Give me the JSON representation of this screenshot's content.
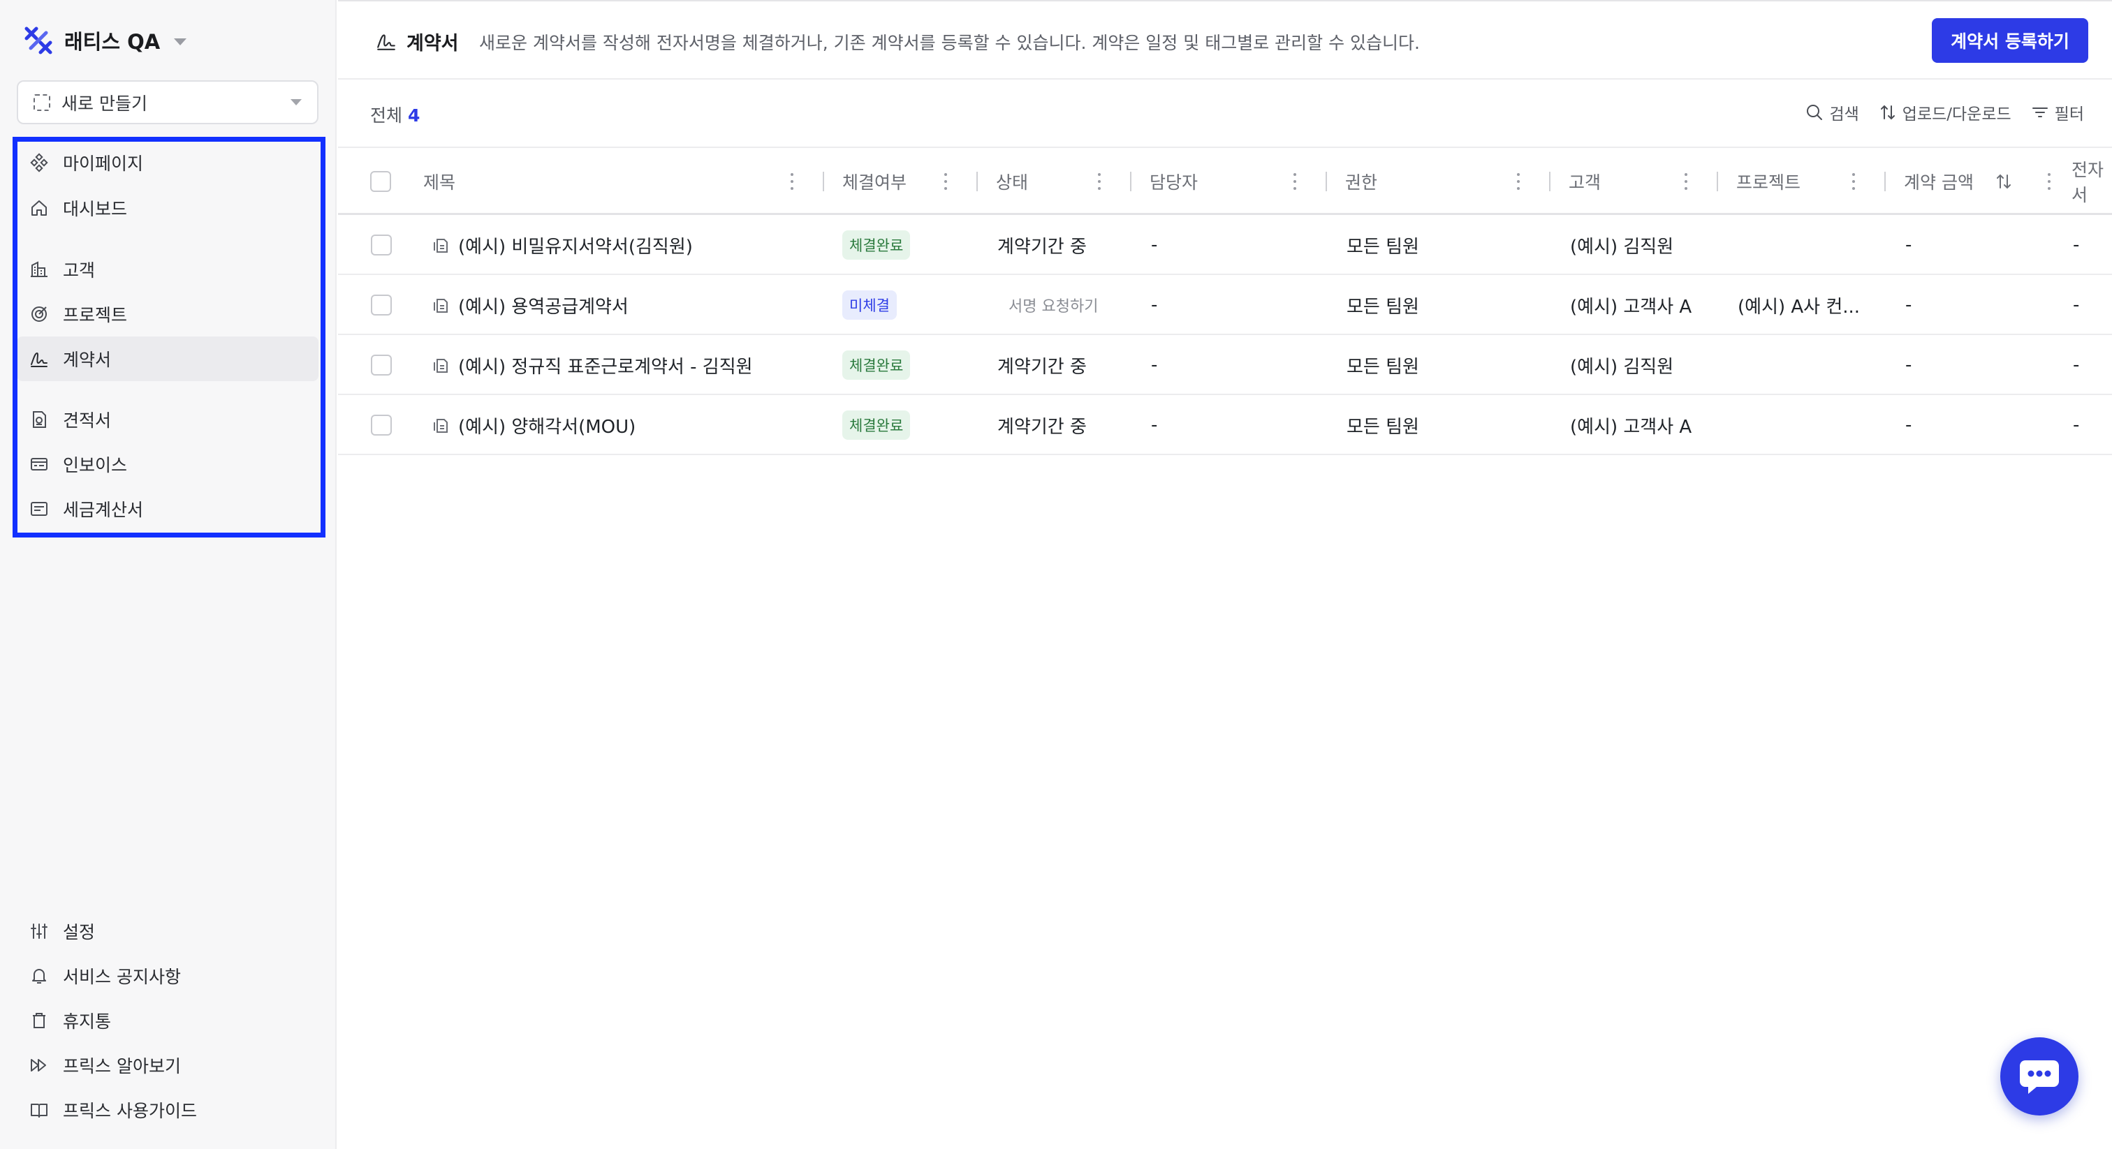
{
  "workspace": {
    "name": "래티스 QA",
    "accent": "#2d3be6"
  },
  "sidebar": {
    "new_button": "새로 만들기",
    "items": [
      {
        "label": "마이페이지",
        "icon": "diamond-grid-icon"
      },
      {
        "label": "대시보드",
        "icon": "home-icon"
      },
      {
        "label": "고객",
        "icon": "building-icon"
      },
      {
        "label": "프로젝트",
        "icon": "target-icon"
      },
      {
        "label": "계약서",
        "icon": "signature-icon",
        "active": true
      },
      {
        "label": "견적서",
        "icon": "quote-doc-icon"
      },
      {
        "label": "인보이스",
        "icon": "invoice-icon"
      },
      {
        "label": "세금계산서",
        "icon": "receipt-icon"
      }
    ],
    "bottom_items": [
      {
        "label": "설정",
        "icon": "sliders-icon"
      },
      {
        "label": "서비스 공지사항",
        "icon": "bell-icon"
      },
      {
        "label": "휴지통",
        "icon": "trash-icon"
      },
      {
        "label": "프릭스 알아보기",
        "icon": "fast-forward-icon"
      },
      {
        "label": "프릭스 사용가이드",
        "icon": "book-icon"
      }
    ]
  },
  "header": {
    "title": "계약서",
    "description": "새로운 계약서를 작성해 전자서명을 체결하거나, 기존 계약서를 등록할 수 있습니다. 계약은 일정 및 태그별로 관리할 수 있습니다.",
    "register_button": "계약서 등록하기"
  },
  "subbar": {
    "total_label": "전체",
    "total_count": "4",
    "search": "검색",
    "upload_download": "업로드/다운로드",
    "filter": "필터"
  },
  "table": {
    "columns": [
      "제목",
      "체결여부",
      "상태",
      "담당자",
      "권한",
      "고객",
      "프로젝트",
      "계약 금액",
      "전자서"
    ],
    "rows": [
      {
        "title": "(예시) 비밀유지서약서(김직원)",
        "signed": "체결완료",
        "signed_type": "done",
        "status": "계약기간 중",
        "manager": "-",
        "permission": "모든 팀원",
        "customer": "(예시) 김직원",
        "project": "",
        "amount": "-",
        "esign": "-"
      },
      {
        "title": "(예시) 용역공급계약서",
        "signed": "미체결",
        "signed_type": "pending",
        "status": "서명 요청하기",
        "manager": "-",
        "permission": "모든 팀원",
        "customer": "(예시) 고객사 A",
        "project": "(예시) A사 컨...",
        "amount": "-",
        "esign": "-"
      },
      {
        "title": "(예시) 정규직 표준근로계약서 - 김직원",
        "signed": "체결완료",
        "signed_type": "done",
        "status": "계약기간 중",
        "manager": "-",
        "permission": "모든 팀원",
        "customer": "(예시) 김직원",
        "project": "",
        "amount": "-",
        "esign": "-"
      },
      {
        "title": "(예시) 양해각서(MOU)",
        "signed": "체결완료",
        "signed_type": "done",
        "status": "계약기간 중",
        "manager": "-",
        "permission": "모든 팀원",
        "customer": "(예시) 고객사 A",
        "project": "",
        "amount": "-",
        "esign": "-"
      }
    ]
  },
  "chat": {
    "icon": "chat-bubble-icon"
  }
}
